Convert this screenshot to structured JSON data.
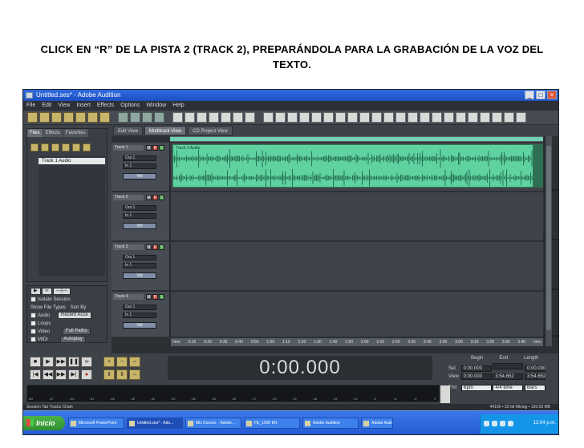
{
  "caption": "CLICK EN “R” DE LA PISTA 2 (TRACK 2), PREPARÁNDOLA PARA LA GRABACIÓN DE LA VOZ DEL TEXTO.",
  "window": {
    "title": "Untitled.ses* - Adobe Audition",
    "controls": {
      "minimize": "_",
      "maximize": "□",
      "close": "×"
    }
  },
  "menu": [
    "File",
    "Edit",
    "View",
    "Insert",
    "Effects",
    "Options",
    "Window",
    "Help"
  ],
  "mode_tabs": [
    "Edit View",
    "Multitrack View",
    "CD Project View"
  ],
  "files_panel": {
    "tabs": [
      "Files",
      "Effects",
      "Favorites"
    ],
    "items": [
      "Track 1 Audio"
    ]
  },
  "left_lower": {
    "options": [
      "Show File Types",
      "Sort By"
    ],
    "sort_value": "Recent Acce",
    "types": [
      "Audio",
      "Loops",
      "Video",
      "MIDI"
    ],
    "buttons": [
      "Full Paths",
      "Autoplay"
    ],
    "auto_label": "Isolate Session"
  },
  "tracks": [
    {
      "name": "Track 1",
      "out": "Out 1",
      "in": "In 1",
      "volume": "Vol",
      "clip": "Track 1 Audio",
      "has_audio": true
    },
    {
      "name": "Track 2",
      "out": "Out 1",
      "in": "In 1",
      "volume": "Vol",
      "clip": "",
      "has_audio": false
    },
    {
      "name": "Track 3",
      "out": "Out 1",
      "in": "In 1",
      "volume": "Vol",
      "clip": "",
      "has_audio": false
    },
    {
      "name": "Track 4",
      "out": "Out 1",
      "in": "In 1",
      "volume": "Vol",
      "clip": "",
      "has_audio": false
    }
  ],
  "track_buttons": {
    "mute": "M",
    "record": "R",
    "solo": "S"
  },
  "ruler_ticks": [
    "hms",
    "0:10",
    "0:20",
    "0:30",
    "0:40",
    "0:50",
    "1:00",
    "1:10",
    "1:20",
    "1:30",
    "1:40",
    "1:50",
    "2:00",
    "2:10",
    "2:20",
    "2:30",
    "2:40",
    "2:50",
    "3:00",
    "3:10",
    "3:20",
    "3:30",
    "3:40",
    "hms"
  ],
  "transport": {
    "row1": [
      "■",
      "▶",
      "▶▶",
      "❚❚",
      "∞"
    ],
    "row2": [
      "|◀",
      "◀◀",
      "▶▶",
      "▶|",
      "●"
    ],
    "zoom": [
      "+",
      "−",
      "⇔",
      "⇕",
      "⇕",
      "⇔"
    ]
  },
  "timecode": "0:00.000",
  "selection_panel": {
    "headers": [
      "Begin",
      "End",
      "Length"
    ],
    "sel_label": "Sel",
    "view_label": "View",
    "sel_values": [
      "0:00.000",
      "",
      "0:00.000"
    ],
    "view_values": [
      "0:00.000",
      "3:54.652",
      "3:54.652"
    ],
    "format_label": "Fmt",
    "format_values": [
      "Bpm",
      "4/4 time",
      "Bars"
    ]
  },
  "level_scale": [
    "dB",
    "-57",
    "-54",
    "-51",
    "-48",
    "-45",
    "-42",
    "-39",
    "-36",
    "-33",
    "-30",
    "-27",
    "-24",
    "-21",
    "-18",
    "-15",
    "-12",
    "-9",
    "-6",
    "-3",
    "0"
  ],
  "status": {
    "left": "Session Tab Tracks Chain",
    "right": "44100 • 32-bit Mixing • 155.00 MB"
  },
  "taskbar": {
    "start": "Inicio",
    "items": [
      "Microsoft PowerPoint",
      "Untitled.ses* - Ado...",
      "Mis Docum. - Adobe...",
      "FE_1000 EN",
      "Adobe Audition",
      "Adobe Audition"
    ],
    "clock": "12:04 p.m."
  }
}
